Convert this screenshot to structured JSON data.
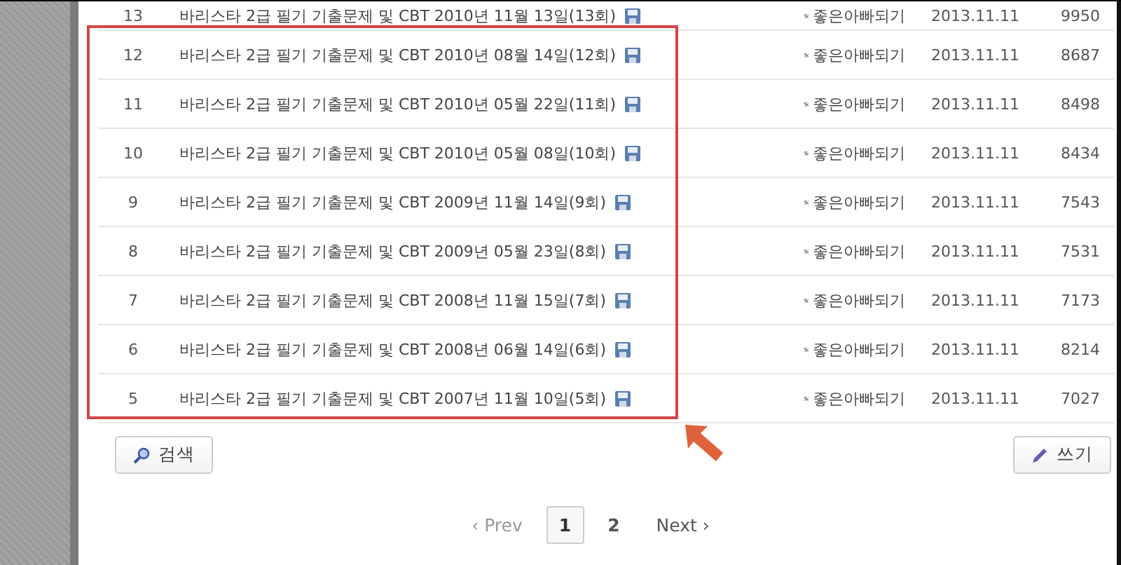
{
  "posts": [
    {
      "number": "13",
      "title": "바리스타 2급 필기 기출문제 및 CBT 2010년 11월 13일(13회)",
      "attachment": true,
      "author": "좋은아빠되기",
      "date": "2013.11.11",
      "views": "9950"
    },
    {
      "number": "12",
      "title": "바리스타 2급 필기 기출문제 및 CBT 2010년 08월 14일(12회)",
      "attachment": true,
      "author": "좋은아빠되기",
      "date": "2013.11.11",
      "views": "8687"
    },
    {
      "number": "11",
      "title": "바리스타 2급 필기 기출문제 및 CBT 2010년 05월 22일(11회)",
      "attachment": true,
      "author": "좋은아빠되기",
      "date": "2013.11.11",
      "views": "8498"
    },
    {
      "number": "10",
      "title": "바리스타 2급 필기 기출문제 및 CBT 2010년 05월 08일(10회)",
      "attachment": true,
      "author": "좋은아빠되기",
      "date": "2013.11.11",
      "views": "8434"
    },
    {
      "number": "9",
      "title": "바리스타 2급 필기 기출문제 및 CBT 2009년 11월 14일(9회)",
      "attachment": true,
      "author": "좋은아빠되기",
      "date": "2013.11.11",
      "views": "7543"
    },
    {
      "number": "8",
      "title": "바리스타 2급 필기 기출문제 및 CBT 2009년 05월 23일(8회)",
      "attachment": true,
      "author": "좋은아빠되기",
      "date": "2013.11.11",
      "views": "7531"
    },
    {
      "number": "7",
      "title": "바리스타 2급 필기 기출문제 및 CBT 2008년 11월 15일(7회)",
      "attachment": true,
      "author": "좋은아빠되기",
      "date": "2013.11.11",
      "views": "7173"
    },
    {
      "number": "6",
      "title": "바리스타 2급 필기 기출문제 및 CBT 2008년 06월 14일(6회)",
      "attachment": true,
      "author": "좋은아빠되기",
      "date": "2013.11.11",
      "views": "8214"
    },
    {
      "number": "5",
      "title": "바리스타 2급 필기 기출문제 및 CBT 2007년 11월 10일(5회)",
      "attachment": true,
      "author": "좋은아빠되기",
      "date": "2013.11.11",
      "views": "7027"
    }
  ],
  "buttons": {
    "search": "검색",
    "write": "쓰기"
  },
  "pagination": {
    "prev": {
      "label": "‹ Prev",
      "disabled": true
    },
    "pages": [
      {
        "label": "1",
        "selected": true
      },
      {
        "label": "2",
        "selected": false
      }
    ],
    "next": {
      "label": "Next ›",
      "disabled": false
    }
  }
}
